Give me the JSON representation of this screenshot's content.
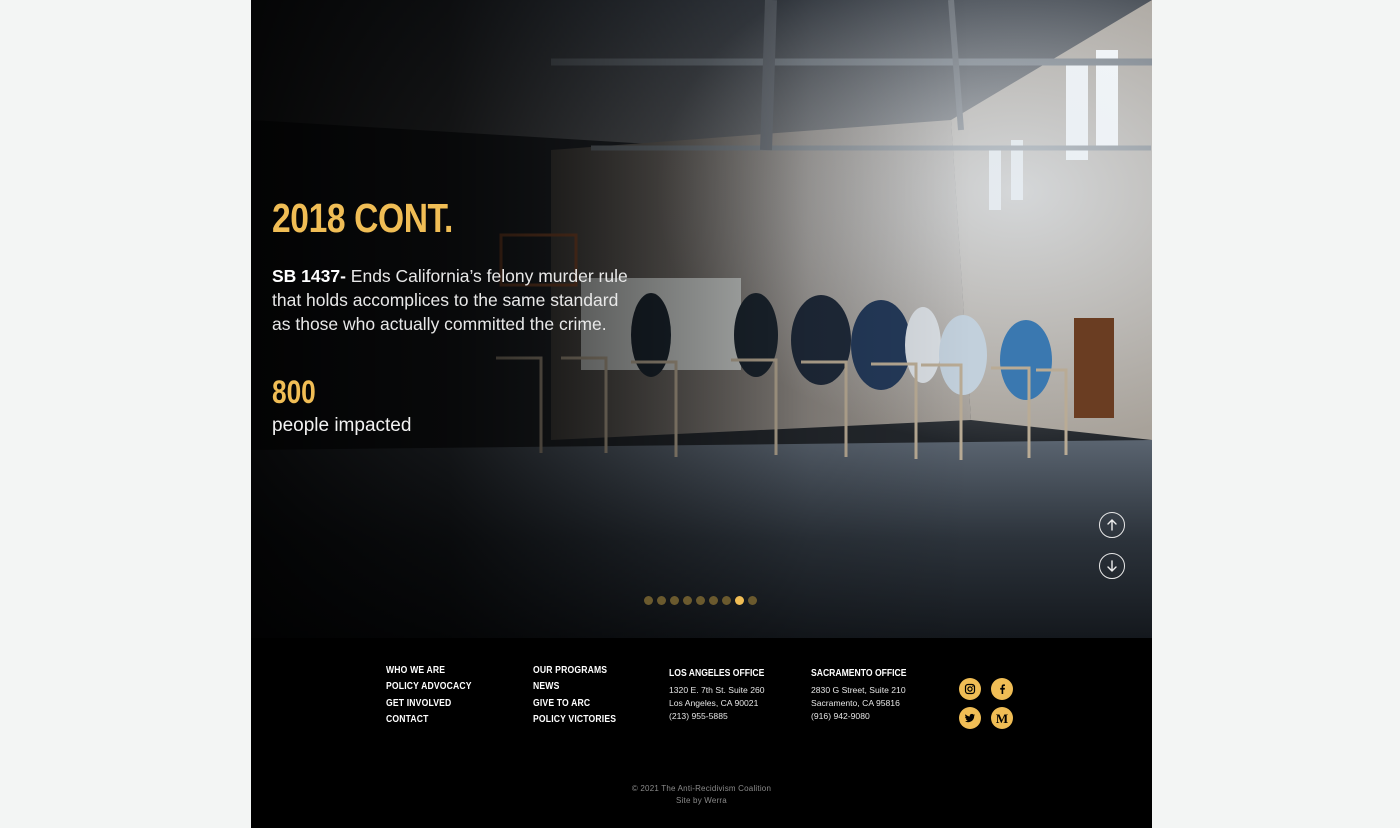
{
  "hero": {
    "year_title": "2018 CONT.",
    "bill_name": "SB 1437-",
    "bill_description": " Ends California’s felony murder rule that holds accomplices to the same standard as those who actually committed the crime.",
    "stat_number": "800",
    "stat_label": "people impacted",
    "scroll_up_icon": "arrow-up-circle-icon",
    "scroll_down_icon": "arrow-down-circle-icon",
    "pagination": {
      "total": 9,
      "active_index": 7
    },
    "colors": {
      "accent": "#f0bd55",
      "text": "#ffffff"
    }
  },
  "footer": {
    "nav_col1": [
      "WHO WE ARE",
      "POLICY ADVOCACY",
      "GET INVOLVED",
      "CONTACT"
    ],
    "nav_col2": [
      "OUR PROGRAMS",
      "NEWS",
      "GIVE TO ARC",
      "POLICY VICTORIES"
    ],
    "la_office": {
      "title": "LOS ANGELES OFFICE",
      "address1": "1320 E. 7th St. Suite 260",
      "address2": "Los Angeles, CA 90021",
      "phone": "(213) 955-5885"
    },
    "sac_office": {
      "title": "SACRAMENTO OFFICE",
      "address1": "2830 G Street, Suite 210",
      "address2": "Sacramento, CA 95816",
      "phone": "(916) 942-9080"
    },
    "social": [
      "instagram-icon",
      "facebook-icon",
      "twitter-icon",
      "medium-icon"
    ],
    "medium_glyph": "M",
    "copyright": "© 2021 The Anti-Recidivism Coalition",
    "credit": "Site by Werra"
  }
}
